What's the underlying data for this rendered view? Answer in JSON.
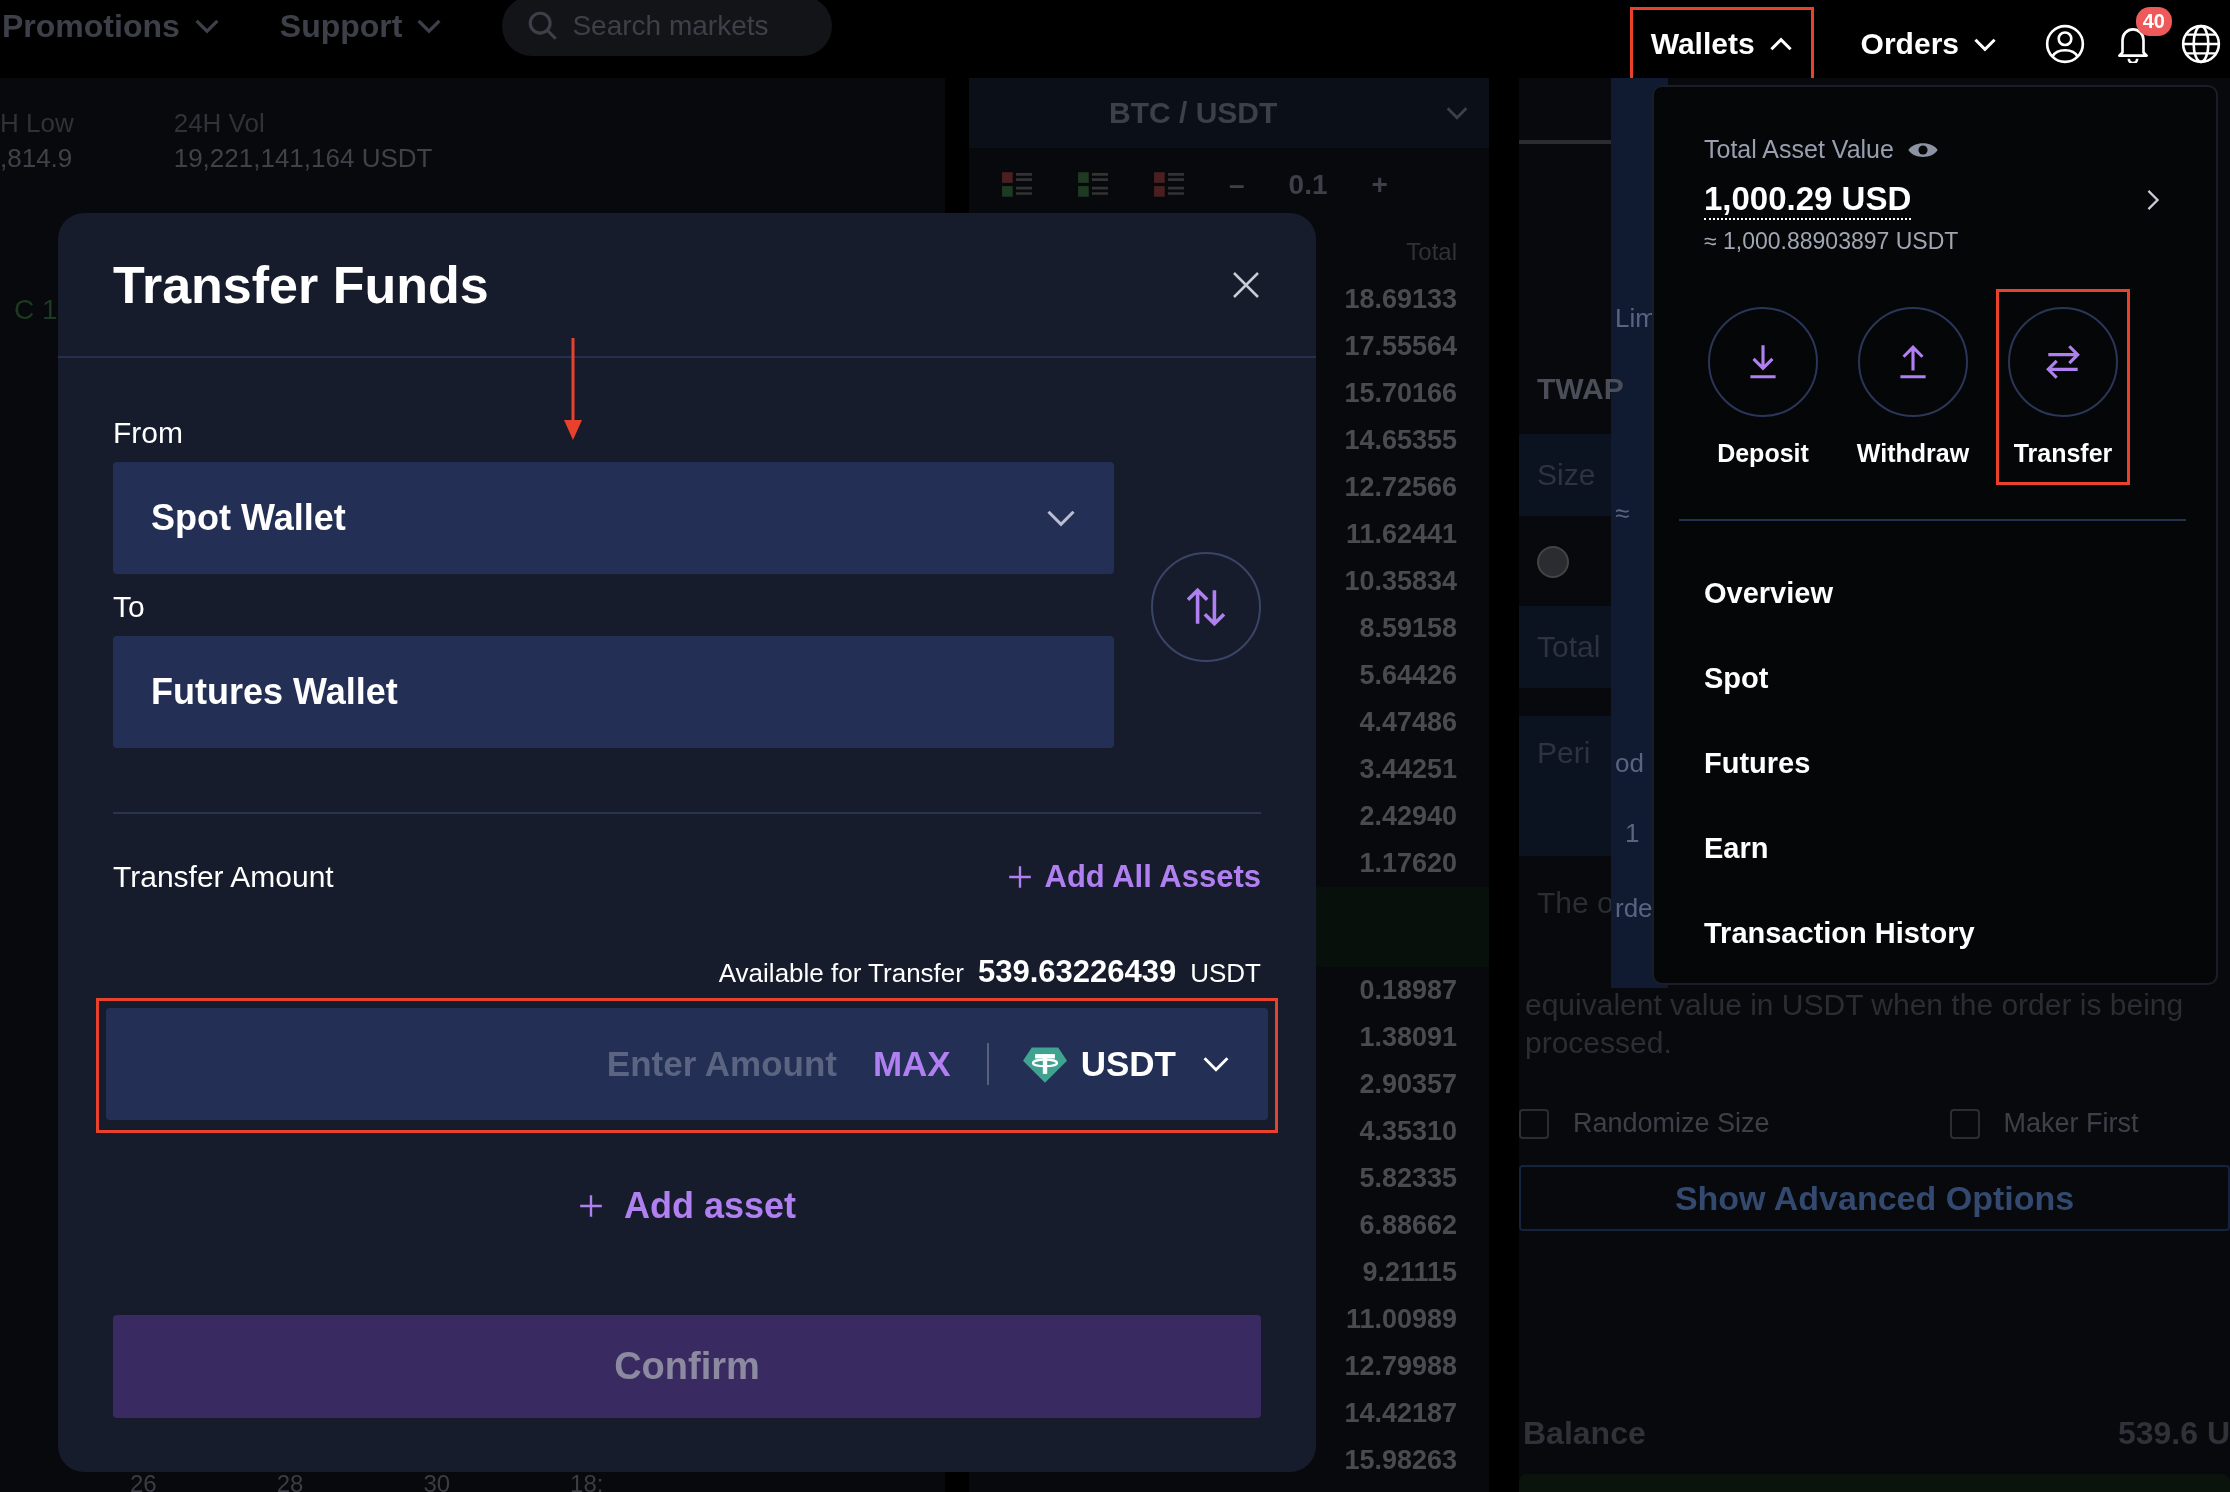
{
  "nav": {
    "items": [
      {
        "label": "Promotions"
      },
      {
        "label": "Support"
      }
    ],
    "search": {
      "placeholder": "Search markets"
    },
    "wallets": {
      "label": "Wallets",
      "expanded": true,
      "annotated": true
    },
    "orders": {
      "label": "Orders",
      "expanded": false
    },
    "notifications": {
      "badge": "40"
    }
  },
  "market_stats": [
    {
      "label": "H Low",
      "value": ",814.9"
    },
    {
      "label": "24H Vol",
      "value": "19,221,141,164 USDT"
    }
  ],
  "chart": {
    "label": "C 1",
    "axis_labels": [
      "26",
      "28",
      "30",
      "18:"
    ]
  },
  "order_book": {
    "pair": "BTC / USDT",
    "decrease": "–",
    "step": "0.1",
    "increase": "+",
    "column": "Total",
    "asks": [
      "18.69133",
      "17.55564",
      "15.70166",
      "14.65355",
      "12.72566",
      "11.62441",
      "10.35834",
      "8.59158",
      "5.64426",
      "4.47486",
      "3.44251",
      "2.42940",
      "1.17620"
    ],
    "bids": [
      "0.18987",
      "1.38091",
      "2.90357",
      "4.35310",
      "5.82335",
      "6.88662",
      "9.21115",
      "11.00989",
      "12.79988",
      "14.42187",
      "15.98263"
    ]
  },
  "order_form": {
    "strip_labels": [
      "Lim",
      "≈",
      "od",
      "1",
      "rde"
    ],
    "tab": "TWAP",
    "size": "Size",
    "total": "Total",
    "period": "Peri",
    "note_start": "The o",
    "note": [
      "equivalent value in USDT when the order is being",
      "processed."
    ],
    "options": [
      {
        "label": "Randomize Size",
        "checked": false
      },
      {
        "label": "Maker First",
        "checked": false
      }
    ],
    "advanced": "Show Advanced Options",
    "balance_label": "Balance",
    "balance_value": "539.6 U"
  },
  "transfer_modal": {
    "title": "Transfer Funds",
    "from": {
      "label": "From",
      "value": "Spot Wallet",
      "dropdown": true
    },
    "to": {
      "label": "To",
      "value": "Futures Wallet",
      "dropdown": false
    },
    "amount_title": "Transfer Amount",
    "add_all": "Add All Assets",
    "available_label": "Available for Transfer",
    "available_value": "539.63226439",
    "available_unit": "USDT",
    "amount": {
      "placeholder": "Enter Amount",
      "max": "MAX",
      "asset": "USDT",
      "annotated": true
    },
    "add_asset": "Add asset",
    "confirm": "Confirm",
    "confirm_disabled": true
  },
  "wallet_menu": {
    "total_label": "Total Asset Value",
    "total_value": "1,000.29 USD",
    "total_approx": "≈ 1,000.88903897 USDT",
    "actions": [
      {
        "label": "Deposit",
        "kind": "deposit",
        "annotated": false
      },
      {
        "label": "Withdraw",
        "kind": "withdraw",
        "annotated": false
      },
      {
        "label": "Transfer",
        "kind": "transfer",
        "annotated": true
      }
    ],
    "items": [
      "Overview",
      "Spot",
      "Futures",
      "Earn",
      "Transaction History"
    ]
  }
}
